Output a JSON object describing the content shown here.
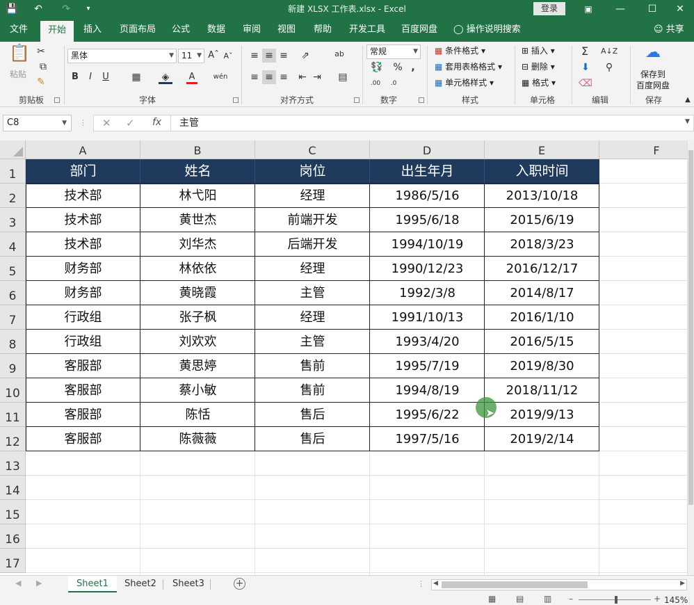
{
  "window": {
    "title": "新建 XLSX 工作表.xlsx  -  Excel",
    "login_label": "登录"
  },
  "tabs": [
    "文件",
    "开始",
    "插入",
    "页面布局",
    "公式",
    "数据",
    "审阅",
    "视图",
    "帮助",
    "开发工具",
    "百度网盘"
  ],
  "active_tab": "开始",
  "tell_me": "操作说明搜索",
  "share_label": "共享",
  "ribbon": {
    "clipboard": {
      "label": "剪贴板",
      "paste": "粘贴"
    },
    "font": {
      "label": "字体",
      "name": "黑体",
      "size": "11",
      "bold": "B",
      "italic": "I",
      "underline": "U"
    },
    "alignment": {
      "label": "对齐方式"
    },
    "number": {
      "label": "数字",
      "format": "常规",
      "percent": "%",
      "comma": ","
    },
    "styles": {
      "label": "样式",
      "cond_format": "条件格式",
      "table_format": "套用表格格式",
      "cell_styles": "单元格样式"
    },
    "cells": {
      "label": "单元格",
      "insert": "插入",
      "delete": "删除",
      "format": "格式"
    },
    "editing": {
      "label": "编辑"
    },
    "save": {
      "label": "保存",
      "save_to": "保存到",
      "baidu": "百度网盘"
    }
  },
  "formula_bar": {
    "name_box": "C8",
    "value": "主管"
  },
  "columns": [
    "A",
    "B",
    "C",
    "D",
    "E",
    "F"
  ],
  "rows": [
    "1",
    "2",
    "3",
    "4",
    "5",
    "6",
    "7",
    "8",
    "9",
    "10",
    "11",
    "12",
    "13",
    "14",
    "15",
    "16",
    "17"
  ],
  "table": {
    "headers": [
      "部门",
      "姓名",
      "岗位",
      "出生年月",
      "入职时间"
    ],
    "records": [
      [
        "技术部",
        "林弋阳",
        "经理",
        "1986/5/16",
        "2013/10/18"
      ],
      [
        "技术部",
        "黄世杰",
        "前端开发",
        "1995/6/18",
        "2015/6/19"
      ],
      [
        "技术部",
        "刘华杰",
        "后端开发",
        "1994/10/19",
        "2018/3/23"
      ],
      [
        "财务部",
        "林依依",
        "经理",
        "1990/12/23",
        "2016/12/17"
      ],
      [
        "财务部",
        "黄晓霞",
        "主管",
        "1992/3/8",
        "2014/8/17"
      ],
      [
        "行政组",
        "张子枫",
        "经理",
        "1991/10/13",
        "2016/1/10"
      ],
      [
        "行政组",
        "刘欢欢",
        "主管",
        "1993/4/20",
        "2016/5/15"
      ],
      [
        "客服部",
        "黄思婷",
        "售前",
        "1995/7/19",
        "2019/8/30"
      ],
      [
        "客服部",
        "蔡小敏",
        "售前",
        "1994/8/19",
        "2018/11/12"
      ],
      [
        "客服部",
        "陈恬",
        "售后",
        "1995/6/22",
        "2019/9/13"
      ],
      [
        "客服部",
        "陈薇薇",
        "售后",
        "1997/5/16",
        "2019/2/14"
      ]
    ]
  },
  "sheets": [
    "Sheet1",
    "Sheet2",
    "Sheet3"
  ],
  "active_sheet": "Sheet1",
  "zoom": "145%",
  "colors": {
    "excel_green": "#217346",
    "table_header": "#1f3a5c"
  }
}
